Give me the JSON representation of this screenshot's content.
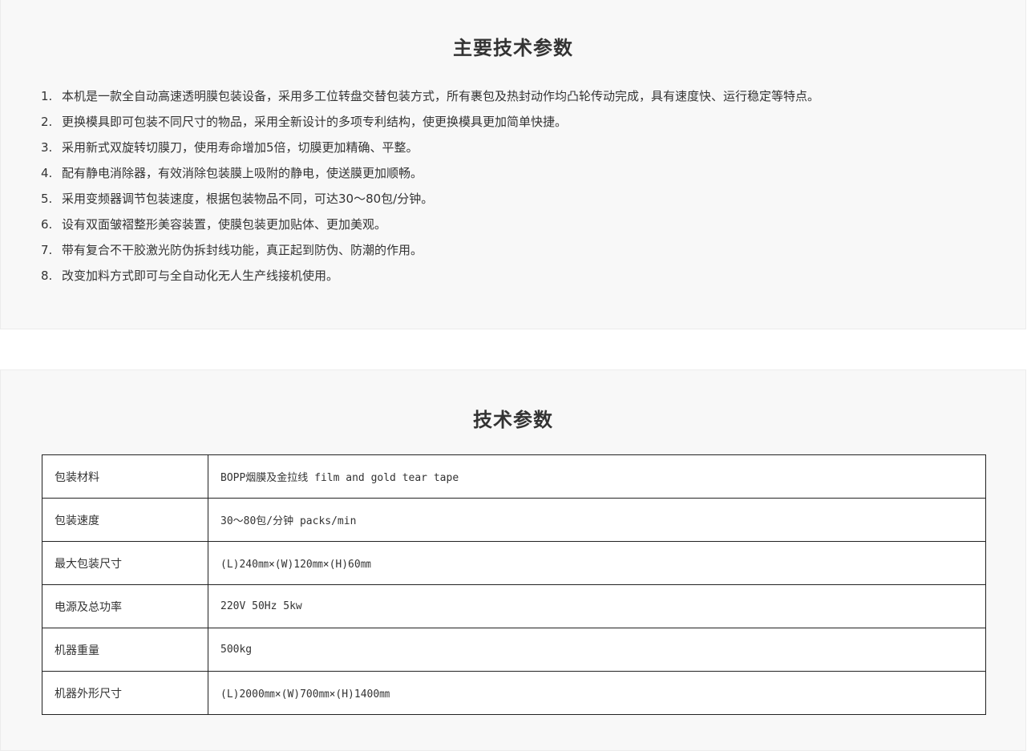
{
  "features": {
    "title": "主要技术参数",
    "items": [
      {
        "num": "1.",
        "text": "本机是一款全自动高速透明膜包装设备，采用多工位转盘交替包装方式，所有裹包及热封动作均凸轮传动完成，具有速度快、运行稳定等特点。"
      },
      {
        "num": "2.",
        "text": "更换模具即可包装不同尺寸的物品，采用全新设计的多项专利结构，使更换模具更加简单快捷。"
      },
      {
        "num": "3.",
        "text": "采用新式双旋转切膜刀，使用寿命增加5倍，切膜更加精确、平整。"
      },
      {
        "num": "4.",
        "text": "配有静电消除器，有效消除包装膜上吸附的静电，使送膜更加顺畅。"
      },
      {
        "num": "5.",
        "text": "采用变频器调节包装速度，根据包装物品不同，可达30～80包/分钟。"
      },
      {
        "num": "6.",
        "text": "设有双面皱褶整形美容装置，使膜包装更加贴体、更加美观。"
      },
      {
        "num": "7.",
        "text": "带有复合不干胶激光防伪拆封线功能，真正起到防伪、防潮的作用。"
      },
      {
        "num": "8.",
        "text": "改变加料方式即可与全自动化无人生产线接机使用。"
      }
    ]
  },
  "specs": {
    "title": "技术参数",
    "rows": [
      {
        "label": "包装材料",
        "value": "BOPP烟膜及金拉线 film and gold tear tape"
      },
      {
        "label": "包装速度",
        "value": "30～80包/分钟 packs/min"
      },
      {
        "label": "最大包装尺寸",
        "value": "(L)240㎜×(W)120㎜×(H)60㎜"
      },
      {
        "label": "电源及总功率",
        "value": "220V 50Hz  5kw"
      },
      {
        "label": "机器重量",
        "value": "500kg"
      },
      {
        "label": "机器外形尺寸",
        "value": "(L)2000㎜×(W)700㎜×(H)1400㎜"
      }
    ]
  }
}
